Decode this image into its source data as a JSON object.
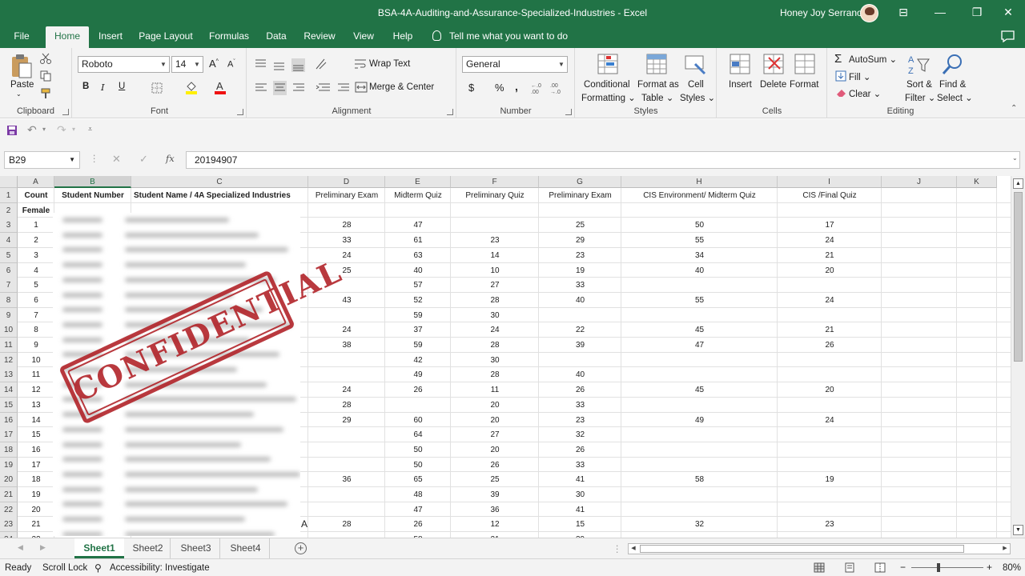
{
  "window": {
    "title": "BSA-4A-Auditing-and-Assurance-Specialized-Industries  -  Excel",
    "user": "Honey Joy Serrano",
    "controls": [
      "⊟",
      "—",
      "❐",
      "✕"
    ]
  },
  "menu": {
    "tabs": [
      "File",
      "Home",
      "Insert",
      "Page Layout",
      "Formulas",
      "Data",
      "Review",
      "View",
      "Help"
    ],
    "active": "Home",
    "tellme": "Tell me what you want to do"
  },
  "ribbon": {
    "clipboard": {
      "label": "Clipboard",
      "paste": "Paste"
    },
    "font": {
      "label": "Font",
      "name": "Roboto",
      "size": "14",
      "bold": "B",
      "italic": "I",
      "underline": "U"
    },
    "alignment": {
      "label": "Alignment",
      "wrap": "Wrap Text",
      "merge": "Merge & Center"
    },
    "number": {
      "label": "Number",
      "format": "General",
      "currency": "$",
      "percent": "%",
      "comma": ","
    },
    "styles": {
      "label": "Styles",
      "conditional": [
        "Conditional",
        "Formatting"
      ],
      "format_table": [
        "Format as",
        "Table"
      ],
      "cell_styles": [
        "Cell",
        "Styles"
      ]
    },
    "cells": {
      "label": "Cells",
      "insert": "Insert",
      "delete": "Delete",
      "format": "Format"
    },
    "editing": {
      "label": "Editing",
      "autosum": "AutoSum",
      "fill": "Fill",
      "clear": "Clear",
      "sort": [
        "Sort &",
        "Filter"
      ],
      "find": [
        "Find &",
        "Select"
      ]
    }
  },
  "formula_bar": {
    "name_box": "B29",
    "formula": "20194907",
    "fx": "fx"
  },
  "sheet": {
    "columns": [
      "A",
      "B",
      "C",
      "D",
      "E",
      "F",
      "G",
      "H",
      "I",
      "J",
      "K"
    ],
    "selected_column": "B",
    "headers": [
      "Count",
      "Student Number",
      "Student Name / 4A Specialized Industries",
      "Preliminary Exam",
      "Midterm Quiz",
      "Preliminary Quiz",
      "Preliminary Exam",
      "CIS Environment/ Midterm Quiz",
      "CIS /Final Quiz",
      "",
      ""
    ],
    "section_label": "Female",
    "rows": [
      {
        "n": "3",
        "count": "1",
        "d": "28",
        "e": "47",
        "f": "",
        "g": "25",
        "h": "50",
        "i": "17"
      },
      {
        "n": "4",
        "count": "2",
        "d": "33",
        "e": "61",
        "f": "23",
        "g": "29",
        "h": "55",
        "i": "24"
      },
      {
        "n": "5",
        "count": "3",
        "d": "24",
        "e": "63",
        "f": "14",
        "g": "23",
        "h": "34",
        "i": "21"
      },
      {
        "n": "6",
        "count": "4",
        "d": "25",
        "e": "40",
        "f": "10",
        "g": "19",
        "h": "40",
        "i": "20"
      },
      {
        "n": "7",
        "count": "5",
        "d": "",
        "e": "57",
        "f": "27",
        "g": "33",
        "h": "",
        "i": ""
      },
      {
        "n": "8",
        "count": "6",
        "d": "43",
        "e": "52",
        "f": "28",
        "g": "40",
        "h": "55",
        "i": "24"
      },
      {
        "n": "9",
        "count": "7",
        "d": "",
        "e": "59",
        "f": "30",
        "g": "",
        "h": "",
        "i": ""
      },
      {
        "n": "10",
        "count": "8",
        "d": "24",
        "e": "37",
        "f": "24",
        "g": "22",
        "h": "45",
        "i": "21"
      },
      {
        "n": "11",
        "count": "9",
        "d": "38",
        "e": "59",
        "f": "28",
        "g": "39",
        "h": "47",
        "i": "26"
      },
      {
        "n": "12",
        "count": "10",
        "d": "",
        "e": "42",
        "f": "30",
        "g": "",
        "h": "",
        "i": ""
      },
      {
        "n": "13",
        "count": "11",
        "d": "",
        "e": "49",
        "f": "28",
        "g": "40",
        "h": "",
        "i": ""
      },
      {
        "n": "14",
        "count": "12",
        "d": "24",
        "e": "26",
        "f": "11",
        "g": "26",
        "h": "45",
        "i": "20"
      },
      {
        "n": "15",
        "count": "13",
        "d": "28",
        "e": "",
        "f": "20",
        "g": "33",
        "h": "",
        "i": ""
      },
      {
        "n": "16",
        "count": "14",
        "d": "29",
        "e": "60",
        "f": "20",
        "g": "23",
        "h": "49",
        "i": "24"
      },
      {
        "n": "17",
        "count": "15",
        "d": "",
        "e": "64",
        "f": "27",
        "g": "32",
        "h": "",
        "i": ""
      },
      {
        "n": "18",
        "count": "16",
        "d": "",
        "e": "50",
        "f": "20",
        "g": "26",
        "h": "",
        "i": ""
      },
      {
        "n": "19",
        "count": "17",
        "d": "",
        "e": "50",
        "f": "26",
        "g": "33",
        "h": "",
        "i": ""
      },
      {
        "n": "20",
        "count": "18",
        "d": "36",
        "e": "65",
        "f": "25",
        "g": "41",
        "h": "58",
        "i": "19"
      },
      {
        "n": "21",
        "count": "19",
        "d": "",
        "e": "48",
        "f": "39",
        "g": "30",
        "h": "",
        "i": ""
      },
      {
        "n": "22",
        "count": "20",
        "d": "",
        "e": "47",
        "f": "36",
        "g": "41",
        "h": "",
        "i": ""
      },
      {
        "n": "23",
        "count": "21",
        "d": "28",
        "e": "26",
        "f": "12",
        "g": "15",
        "h": "32",
        "i": "23"
      },
      {
        "n": "24",
        "count": "22",
        "d": "",
        "e": "58",
        "f": "21",
        "g": "39",
        "h": "",
        "i": ""
      }
    ],
    "overflow_char": "A",
    "stamp_text": "CONFIDENTIAL"
  },
  "sheet_tabs": [
    "Sheet1",
    "Sheet2",
    "Sheet3",
    "Sheet4"
  ],
  "active_sheet": "Sheet1",
  "status": {
    "ready": "Ready",
    "scroll_lock": "Scroll Lock",
    "accessibility": "Accessibility: Investigate",
    "zoom": "80%"
  },
  "colors": {
    "excel_green": "#217346",
    "stamp_red": "#b01e24",
    "ribbon_bg": "#f3f3f3"
  }
}
